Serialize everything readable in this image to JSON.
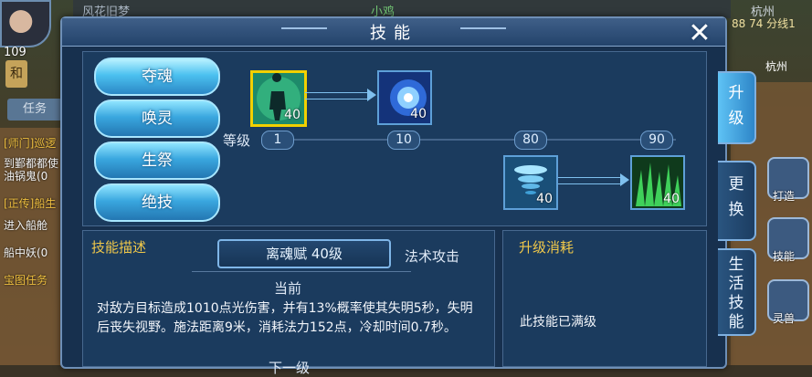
{
  "background": {
    "top_names": [
      "风花旧梦",
      "小鸡"
    ],
    "left_hud": {
      "player_level": "109",
      "tab_icon": "和",
      "tab_tasks": "任务",
      "quests": [
        {
          "text": "[师门]巡逻",
          "color": "#f0c040"
        },
        {
          "text": "到鄞都都使",
          "color": "#f3f3f3"
        },
        {
          "text": "油锅鬼(0",
          "color": "#f3f3f3"
        },
        {
          "text": "[正传]船生",
          "color": "#f0c040"
        },
        {
          "text": "进入船舱",
          "color": "#f3f3f3"
        },
        {
          "text": "船中妖(0",
          "color": "#f3f3f3"
        },
        {
          "text": "宝图任务",
          "color": "#f0c040"
        }
      ]
    },
    "right_hud": {
      "city": "杭州",
      "coords": "88 74 分线1",
      "map_label": "杭州",
      "icon_labels": [
        "打造",
        "技能",
        "灵兽"
      ]
    }
  },
  "panel": {
    "title": "技能",
    "close_glyph": "✕",
    "skill_list": [
      "夺魂",
      "唤灵",
      "生祭",
      "绝技"
    ],
    "selected_skill_index": 0,
    "tree": {
      "level_label": "等级",
      "levels": [
        "1",
        "10",
        "80",
        "90"
      ],
      "icons": [
        {
          "name": "skill-1",
          "level": "40",
          "color": "#3fc88a"
        },
        {
          "name": "skill-2",
          "level": "40",
          "color": "#3c8ef0"
        },
        {
          "name": "skill-3",
          "level": "40",
          "color": "#4fb8e8"
        },
        {
          "name": "skill-4",
          "level": "40",
          "color": "#3fd05a"
        }
      ]
    },
    "description": {
      "heading": "技能描述",
      "skill_name": "离魂赋 40级",
      "skill_type": "法术攻击",
      "current_label": "当前",
      "current_text": "对敌方目标造成1010点光伤害，并有13%概率使其失明5秒，失明后丧失视野。施法距离9米，消耗法力152点，冷却时间0.7秒。",
      "next_label": "下一级"
    },
    "cost": {
      "heading": "升级消耗",
      "text": "此技能已满级"
    },
    "side_tabs": [
      {
        "label": "升级",
        "active": true
      },
      {
        "label": "更换",
        "active": false
      },
      {
        "label": "生活技能",
        "active": false
      }
    ]
  }
}
